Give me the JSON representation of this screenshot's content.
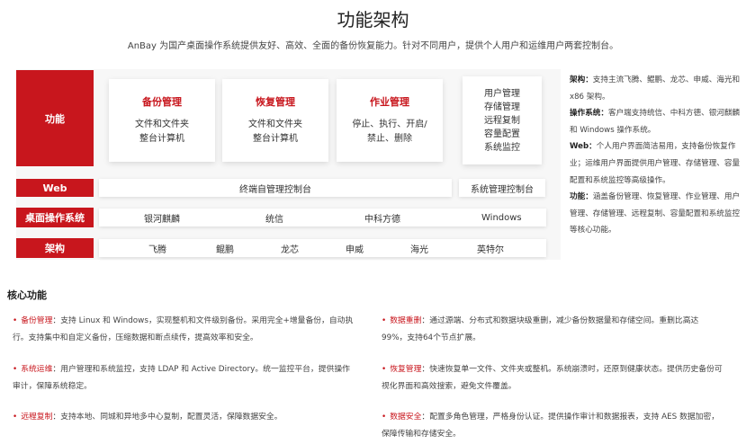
{
  "header": {
    "title": "功能架构",
    "subtitle": "AnBay 为国产桌面操作系统提供友好、高效、全面的备份恢复能力。针对不同用户，提供个人用户和运维用户两套控制台。"
  },
  "architecture": {
    "row_labels": {
      "function": "功能",
      "web": "Web",
      "os": "桌面操作系统",
      "arch": "架构"
    },
    "cards": [
      {
        "title": "备份管理",
        "lines": [
          "文件和文件夹",
          "整台计算机"
        ]
      },
      {
        "title": "恢复管理",
        "lines": [
          "文件和文件夹",
          "整台计算机"
        ]
      },
      {
        "title": "作业管理",
        "lines": [
          "停止、执行、开启/",
          "禁止、删除"
        ]
      }
    ],
    "side_card": [
      "用户管理",
      "存储管理",
      "远程复制",
      "容量配置",
      "系统监控"
    ],
    "web_main": "终端自管理控制台",
    "web_side": "系统管理控制台",
    "os_items": [
      "银河麒麟",
      "统信",
      "中科方德",
      "Windows"
    ],
    "arch_items": [
      "飞腾",
      "鲲鹏",
      "龙芯",
      "申威",
      "海光",
      "英特尔"
    ]
  },
  "notes": [
    {
      "label": "架构：",
      "text": "支持主流飞腾、鲲鹏、龙芯、申威、海光和 x86 架构。"
    },
    {
      "label": "操作系统：",
      "text": "客户端支持统信、中科方德、银河麒麟和 Windows 操作系统。"
    },
    {
      "label": "Web：",
      "text": "个人用户界面简洁易用，支持备份恢复作业；运维用户界面提供用户管理、存储管理、容量配置和系统监控等高级操作。"
    },
    {
      "label": "功能：",
      "text": "涵盖备份管理、恢复管理、作业管理、用户管理、存储管理、远程复制、容量配置和系统监控等核心功能。"
    }
  ],
  "core": {
    "title": "核心功能",
    "left": [
      {
        "label": "备份管理",
        "text": "：支持 Linux 和 Windows，实现整机和文件级别备份。采用完全+增量备份，自动执行。支持集中和自定义备份，压缩数据和断点续传，提高效率和安全。"
      },
      {
        "label": "系统运维",
        "text": "：用户管理和系统监控，支持 LDAP 和 Active Directory。统一监控平台，提供操作审计，保障系统稳定。"
      },
      {
        "label": "远程复制",
        "text": "：支持本地、同城和异地多中心复制，配置灵活，保障数据安全。"
      }
    ],
    "right": [
      {
        "label": "数据重删",
        "text": "：通过源端、分布式和数据块级重删，减少备份数据量和存储空间。重删比高达 99%，支持64个节点扩展。"
      },
      {
        "label": "恢复管理",
        "text": "：快速恢复单一文件、文件夹或整机。系统崩溃时，还原到健康状态。提供历史备份可视化界面和高效搜索，避免文件覆盖。"
      },
      {
        "label": "数据安全",
        "text": "：配置多角色管理，严格身份认证。提供操作审计和数据报表，支持 AES 数据加密，保障传输和存储安全。"
      }
    ]
  },
  "colors": {
    "accent": "#c8161d"
  }
}
